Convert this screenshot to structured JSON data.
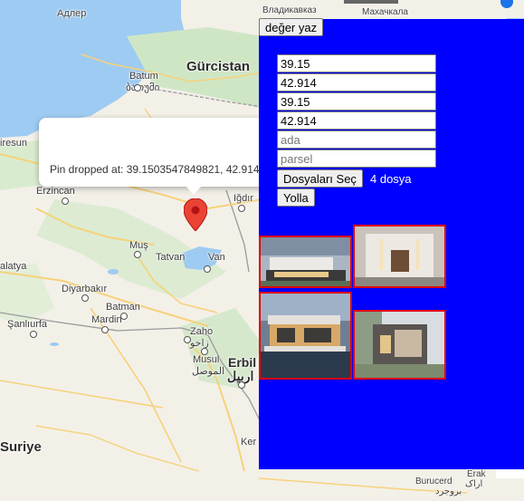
{
  "map": {
    "places": {
      "adler": "Адлер",
      "vladikavkaz": "Владикавказ",
      "mahachkala": "Махачкала",
      "batum": "Batum",
      "batum_geo": "ბათუმი",
      "gurcistan": "Gürcistan",
      "giresun": "iresun",
      "erzincan": "Erzincan",
      "igdir": "Iğdır",
      "mus": "Muş",
      "tatvan": "Tatvan",
      "van": "Van",
      "malatya": "alatya",
      "diyarbakir": "Diyarbakır",
      "batman": "Batman",
      "sanliurfa": "Şanlıurfa",
      "mardin": "Mardin",
      "zaho": "Zaho",
      "zaho_ar": "زاخو",
      "musul": "Musul",
      "musul_ar": "الموصل",
      "erbil": "Erbil",
      "erbil_ar": "اربيل",
      "kirkuk": "Ker",
      "suriye": "Suriye",
      "burucerd": "Burucerd",
      "burucerd_fa": "بروجرد",
      "erak": "Erak",
      "erak_fa": "اراک"
    },
    "info_window": {
      "text": "Pin dropped at: 39.1503547849821, 42.914"
    },
    "pin_icon": "map-pin-icon",
    "colors": {
      "water": "#9ecbf2",
      "land": "#f3f0e8",
      "green": "#b8dcb0",
      "road": "#f6d27a",
      "pin": "#ea4335"
    }
  },
  "panel": {
    "write_button": "değer yaz",
    "fields": {
      "lat1": "39.15",
      "lng1": "42.914",
      "lat2": "39.15",
      "lng2": "42.914",
      "ada_placeholder": "ada",
      "parsel_placeholder": "parsel"
    },
    "file_button": "Dosyaları Seç",
    "file_count": "4 dosya",
    "send_button": "Yolla",
    "background": "#0000ff",
    "thumb_border": "#e00000"
  }
}
